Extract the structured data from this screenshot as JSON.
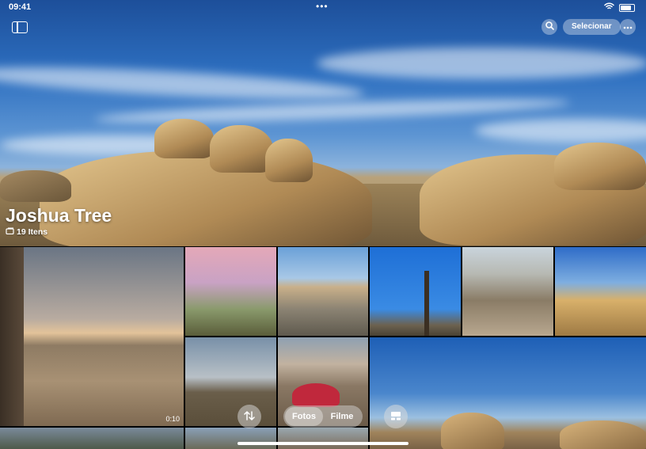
{
  "status": {
    "time": "09:41",
    "dots": "•••"
  },
  "header": {
    "sidebar_icon": "sidebar-icon",
    "search_icon": "magnifier",
    "select_label": "Selecionar",
    "more_icon": "ellipsis"
  },
  "album": {
    "title": "Joshua Tree",
    "count": "19 Itens"
  },
  "grid": {
    "video_duration": "0:10"
  },
  "bottom": {
    "sort_icon": "arrows-up-down",
    "tabs": [
      "Fotos",
      "Filme"
    ],
    "active_tab": "Fotos",
    "view_icon": "view-toggle"
  }
}
